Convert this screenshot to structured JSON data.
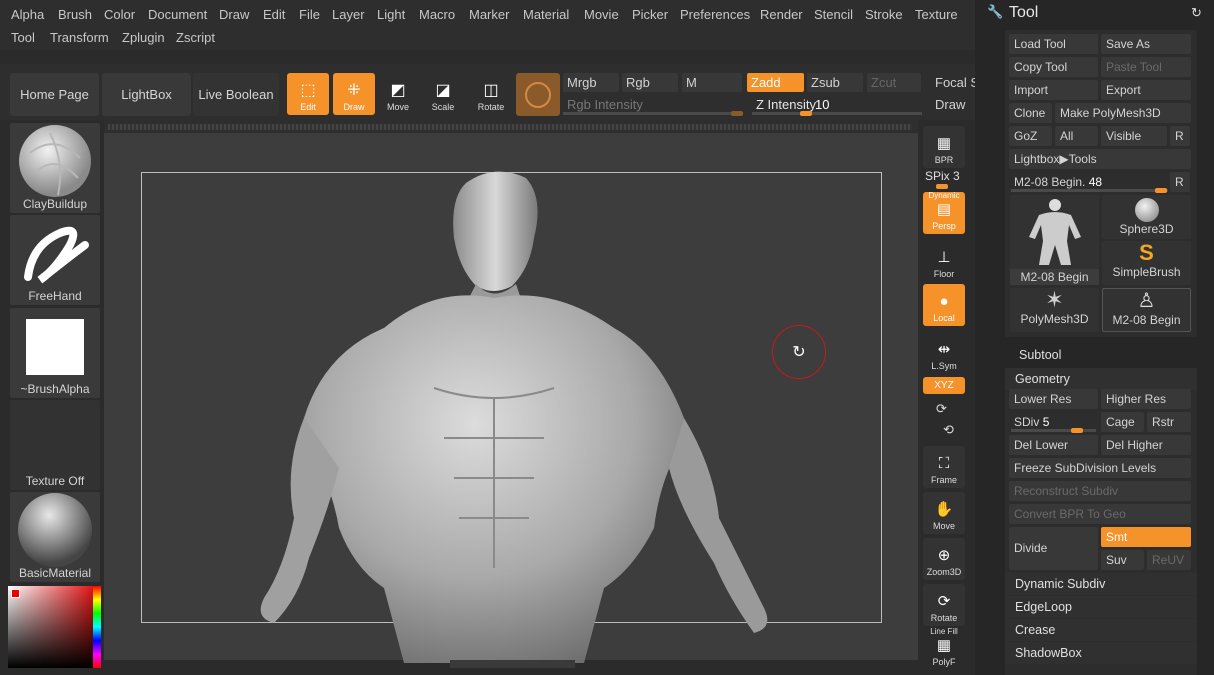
{
  "menu": {
    "row1": [
      "Alpha",
      "Brush",
      "Color",
      "Document",
      "Draw",
      "Edit",
      "File",
      "Layer",
      "Light",
      "Macro",
      "Marker",
      "Material",
      "Movie",
      "Picker",
      "Preferences",
      "Render",
      "Stencil",
      "Stroke",
      "Texture"
    ],
    "row2": [
      "Tool",
      "Transform",
      "Zplugin",
      "Zscript"
    ]
  },
  "toolbar": {
    "home": "Home Page",
    "lightbox": "LightBox",
    "live_boolean": "Live Boolean",
    "edit": "Edit",
    "draw": "Draw",
    "move": "Move",
    "scale": "Scale",
    "rotate": "Rotate",
    "mrgb": "Mrgb",
    "rgb": "Rgb",
    "m": "M",
    "zadd": "Zadd",
    "zsub": "Zsub",
    "zcut": "Zcut",
    "focal": "Focal S",
    "draw_size": "Draw",
    "rgb_intensity": "Rgb Intensity",
    "z_intensity_label": "Z Intensity",
    "z_intensity_value": "10"
  },
  "left_panel": {
    "brush": "ClayBuildup",
    "stroke": "FreeHand",
    "alpha": "~BrushAlpha",
    "texture": "Texture Off",
    "material": "BasicMaterial"
  },
  "right_strip": {
    "bpr": "BPR",
    "spix_label": "SPix",
    "spix_value": "3",
    "dynamic": "Dynamic",
    "persp": "Persp",
    "floor": "Floor",
    "local": "Local",
    "lsym": "L.Sym",
    "xyz": "XYZ",
    "frame": "Frame",
    "move": "Move",
    "zoom3d": "Zoom3D",
    "rotate": "Rotate",
    "linefill": "Line Fill",
    "polyf": "PolyF"
  },
  "tool_panel": {
    "title": "Tool",
    "load_tool": "Load Tool",
    "save_as": "Save As",
    "copy_tool": "Copy Tool",
    "paste_tool": "Paste Tool",
    "import": "Import",
    "export": "Export",
    "clone": "Clone",
    "make_polymesh": "Make PolyMesh3D",
    "goz": "GoZ",
    "all": "All",
    "visible": "Visible",
    "r": "R",
    "lightbox_tools": "Lightbox▶Tools",
    "current_tool_label": "M2-08 Begin.",
    "current_tool_value": "48",
    "tools": [
      "M2-08 Begin",
      "Sphere3D",
      "SimpleBrush",
      "PolyMesh3D",
      "M2-08 Begin"
    ],
    "subtool": "Subtool",
    "geometry": "Geometry",
    "lower_res": "Lower Res",
    "higher_res": "Higher Res",
    "sdiv_label": "SDiv",
    "sdiv_value": "5",
    "cage": "Cage",
    "rstr": "Rstr",
    "del_lower": "Del Lower",
    "del_higher": "Del Higher",
    "freeze": "Freeze SubDivision Levels",
    "reconstruct": "Reconstruct Subdiv",
    "convert_bpr": "Convert BPR To Geo",
    "divide": "Divide",
    "smt": "Smt",
    "suv": "Suv",
    "reuv": "ReUV",
    "dynamic_subdiv": "Dynamic Subdiv",
    "edgeloop": "EdgeLoop",
    "crease": "Crease",
    "shadowbox": "ShadowBox"
  },
  "colors": {
    "accent": "#f5922a",
    "panel": "#262626",
    "canvas": "#3d3d3d"
  }
}
